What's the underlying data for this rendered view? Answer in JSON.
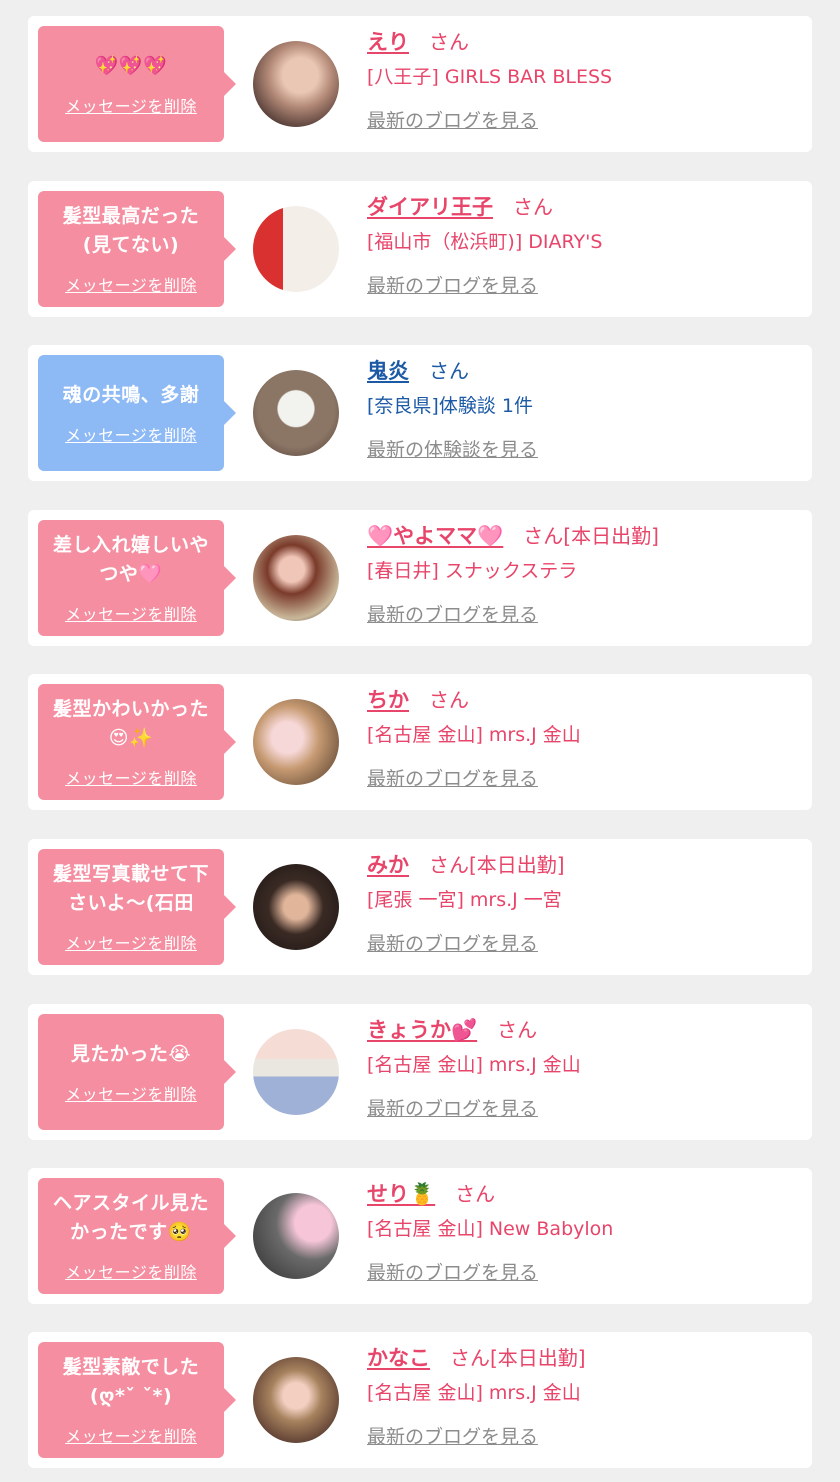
{
  "entries": [
    {
      "message": "💖💖💖",
      "delete_label": "メッセージを削除",
      "name": "えり",
      "honorific": "さん",
      "shop": "[八王子] GIRLS BAR BLESS",
      "link": "最新のブログを見る",
      "theme": "pink"
    },
    {
      "message": "髪型最高だった\n(見てない)",
      "delete_label": "メッセージを削除",
      "name": "ダイアリ王子",
      "honorific": "さん",
      "shop": "[福山市（松浜町)] DIARY'S",
      "link": "最新のブログを見る",
      "theme": "pink"
    },
    {
      "message": "魂の共鳴、多謝",
      "delete_label": "メッセージを削除",
      "name": "鬼炎",
      "honorific": "さん",
      "shop": "[奈良県]体験談 1件",
      "link": "最新の体験談を見る",
      "theme": "blue"
    },
    {
      "message": "差し入れ嬉しいや\nつや🩷",
      "delete_label": "メッセージを削除",
      "name": "🩷やよママ🩷",
      "honorific": "さん[本日出勤]",
      "shop": "[春日井] スナックステラ",
      "link": "最新のブログを見る",
      "theme": "pink"
    },
    {
      "message": "髪型かわいかった\n😍✨",
      "delete_label": "メッセージを削除",
      "name": "ちか",
      "honorific": "さん",
      "shop": "[名古屋 金山] mrs.J 金山",
      "link": "最新のブログを見る",
      "theme": "pink"
    },
    {
      "message": "髪型写真載せて下\nさいよ〜(石田",
      "delete_label": "メッセージを削除",
      "name": "みか",
      "honorific": "さん[本日出勤]",
      "shop": "[尾張 一宮] mrs.J 一宮",
      "link": "最新のブログを見る",
      "theme": "pink"
    },
    {
      "message": "見たかった😭",
      "delete_label": "メッセージを削除",
      "name": "きょうか💕",
      "honorific": "さん",
      "shop": "[名古屋 金山] mrs.J 金山",
      "link": "最新のブログを見る",
      "theme": "pink"
    },
    {
      "message": "ヘアスタイル見た\nかったです🥺",
      "delete_label": "メッセージを削除",
      "name": "せり🍍",
      "honorific": "さん",
      "shop": "[名古屋 金山] New Babylon",
      "link": "最新のブログを見る",
      "theme": "pink"
    },
    {
      "message": "髪型素敵でした\n(ღ*ˇ ˇ*)",
      "delete_label": "メッセージを削除",
      "name": "かなこ",
      "honorific": "さん[本日出勤]",
      "shop": "[名古屋 金山] mrs.J 金山",
      "link": "最新のブログを見る",
      "theme": "pink"
    }
  ],
  "colors": {
    "pink_bubble": "#f58ea0",
    "blue_bubble": "#8db9f5",
    "pink_text": "#e8456a",
    "blue_text": "#1d5aa6",
    "link_gray": "#8c8c8c"
  }
}
